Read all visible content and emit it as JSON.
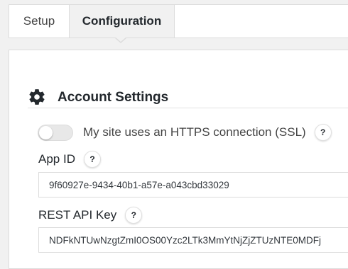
{
  "tabs": {
    "setup": "Setup",
    "configuration": "Configuration"
  },
  "account_settings": {
    "title": "Account Settings",
    "icon": "gear-icon",
    "ssl_label": "My site uses an HTTPS connection (SSL)",
    "ssl_enabled": false,
    "help_glyph": "?",
    "app_id_label": "App ID",
    "app_id_value": "9f60927e-9434-40b1-a57e-a043cbd33029",
    "rest_api_key_label": "REST API Key",
    "rest_api_key_value": "NDFkNTUwNzgtZmI0OS00Yzc2LTk3MmYtNjZjZTUzNTE0MDFj"
  },
  "colors": {
    "background": "#f1f1f1",
    "panel": "#ffffff",
    "border": "#dcdcdc",
    "text": "#23282d"
  }
}
